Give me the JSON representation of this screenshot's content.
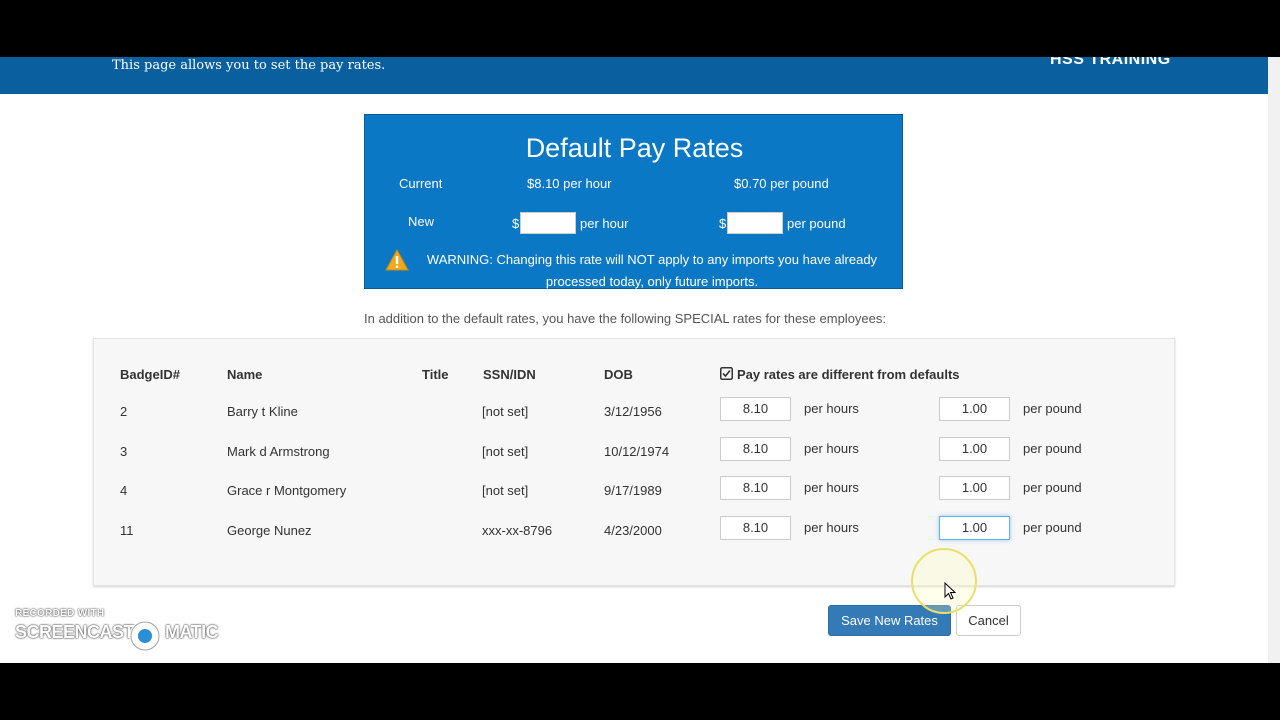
{
  "header": {
    "subtitle": "This page allows you to set the pay rates.",
    "brand": "HSS TRAINING"
  },
  "default_rates": {
    "title": "Default Pay Rates",
    "current_label": "Current",
    "current_hourly": "$8.10 per hour",
    "current_pound": "$0.70 per pound",
    "new_label": "New",
    "dollar_sign": "$",
    "per_hour": "per hour",
    "per_pound": "per pound",
    "warning": "WARNING: Changing this rate will NOT apply to any imports you have already processed today, only future imports."
  },
  "special_note": "In addition to the default rates, you have the following SPECIAL rates for these employees:",
  "table": {
    "headers": {
      "badge": "BadgeID#",
      "name": "Name",
      "title": "Title",
      "ssn": "SSN/IDN",
      "dob": "DOB",
      "different": "Pay rates are different from defaults"
    },
    "unit_hours": "per hours",
    "unit_pound": "per pound",
    "rows": [
      {
        "badge": "2",
        "name": "Barry t Kline",
        "title": "",
        "ssn": "[not set]",
        "dob": "3/12/1956",
        "hourly": "8.10",
        "pound": "1.00"
      },
      {
        "badge": "3",
        "name": "Mark d Armstrong",
        "title": "",
        "ssn": "[not set]",
        "dob": "10/12/1974",
        "hourly": "8.10",
        "pound": "1.00"
      },
      {
        "badge": "4",
        "name": "Grace r Montgomery",
        "title": "",
        "ssn": "[not set]",
        "dob": "9/17/1989",
        "hourly": "8.10",
        "pound": "1.00"
      },
      {
        "badge": "11",
        "name": "George Nunez",
        "title": "",
        "ssn": "xxx-xx-8796",
        "dob": "4/23/2000",
        "hourly": "8.10",
        "pound": "1.00"
      }
    ]
  },
  "buttons": {
    "save": "Save New Rates",
    "cancel": "Cancel"
  },
  "watermark": {
    "small": "RECORDED WITH",
    "left": "SCREENCAST",
    "right": "MATIC"
  },
  "colors": {
    "header_blue": "#0a5f9e",
    "box_blue": "#0a78c5",
    "button_blue": "#337ab7",
    "warning_yellow": "#f0a81e"
  }
}
